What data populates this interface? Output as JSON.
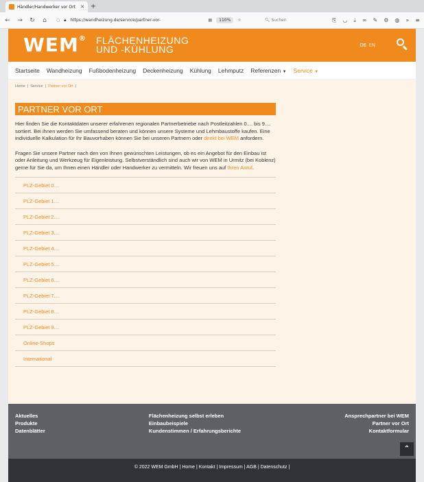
{
  "browser": {
    "tab_title": "Händler/Handwerker vor Ort",
    "tab_close": "✕",
    "new_tab": "+",
    "url": "https://wandheizung.de/service/partner-vor-",
    "zoom": "110%",
    "search_placeholder": "Suchen"
  },
  "header": {
    "logo": "WEM",
    "logo_mark": "®",
    "brand_line1": "FLÄCHENHEIZUNG",
    "brand_line2": "UND -KÜHLUNG",
    "lang_de": "DE",
    "lang_en": "EN"
  },
  "nav": {
    "items": [
      "Startseite",
      "Wandheizung",
      "Fußbodenheizung",
      "Deckenheizung",
      "Kühlung",
      "Lehmputz"
    ],
    "referenzen": "Referenzen",
    "service": "Service"
  },
  "breadcrumb": {
    "home": "Home",
    "service": "Service",
    "current": "Partner vor Ort"
  },
  "main": {
    "title": "PARTNER VOR ORT",
    "para1_a": "Hier finden Sie die Kontaktdaten unserer erfahrenen regionalen Partnerbetriebe nach Postleitzahlen 0.... bis 9.... sortiert. Bei ihnen werden Sie umfassend beraten und können unsere Systeme und Lehmbaustoffe kaufen. Eine individuelle Kalkulation für Ihr Bauvorhaben können Sie bei unseren Partnern oder ",
    "para1_link": "direkt bei WEM",
    "para1_b": " anfordern.",
    "para2_a": "Fragen Sie unsere Partner nach den von Ihnen gewünschten Leistungen, ob es ein Angebot für den Einbau ist oder Anleitung und Werkzeug für Eigenleistung. Selbstverständlich sind auch wir von WEM in Urmitz (bei Koblenz) gerne für Sie da, um Ihnen einen Händler oder Handwerker zu vermitteln. Wir freuen uns auf ",
    "para2_link": "Ihren Anruf",
    "para2_b": ".",
    "regions": [
      "PLZ-Gebiet 0....",
      "PLZ-Gebiet 1....",
      "PLZ-Gebiet 2....",
      "PLZ-Gebiet 3....",
      "PLZ-Gebiet 4....",
      "PLZ-Gebiet 5....",
      "PLZ-Gebiet 6....",
      "PLZ-Gebiet 7....",
      "PLZ-Gebiet 8....",
      "PLZ-Gebiet 9....",
      "Online-Shops",
      "International"
    ]
  },
  "footer": {
    "col1": [
      "Aktuelles",
      "Produkte",
      "Datenblätter"
    ],
    "col2": [
      "Flächenheizung selbst erleben",
      "Einbaubeispiele",
      "Kundenstimmen / Erfahrungsberichte"
    ],
    "col3": [
      "Ansprechpartner bei WEM",
      "Partner vor Ort",
      "Kontaktformular"
    ],
    "copyright": "© 2022 WEM GmbH | Home | Kontakt | Impressum | AGB | Datenschutz |"
  }
}
